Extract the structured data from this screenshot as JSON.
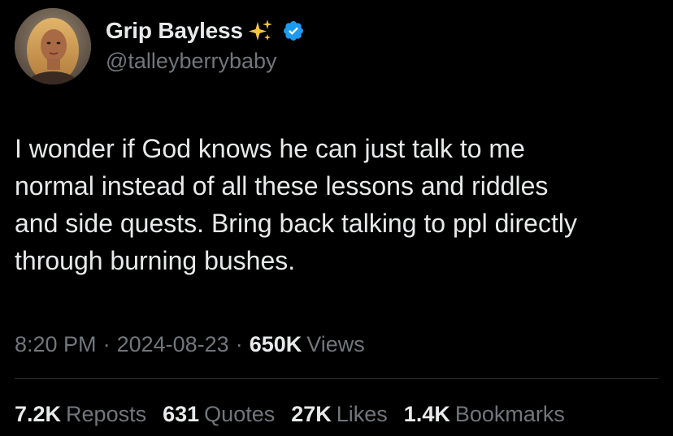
{
  "user": {
    "display_name": "Grip Bayless",
    "handle": "@talleyberrybaby",
    "verified": true,
    "name_emoji": "sparkles-icon",
    "avatar": "profile-photo"
  },
  "tweet": {
    "text_lines": [
      "I wonder if God knows he can just talk to me",
      "normal instead of all these lessons and riddles",
      "and side quests. Bring back talking to ppl directly",
      "through burning bushes."
    ]
  },
  "meta": {
    "time": "8:20 PM",
    "separator": "·",
    "date": "2024-08-23",
    "views_count": "650K",
    "views_label": "Views"
  },
  "stats": {
    "reposts": {
      "count": "7.2K",
      "label": "Reposts"
    },
    "quotes": {
      "count": "631",
      "label": "Quotes"
    },
    "likes": {
      "count": "27K",
      "label": "Likes"
    },
    "bookmarks": {
      "count": "1.4K",
      "label": "Bookmarks"
    }
  },
  "colors": {
    "background": "#000000",
    "primary_text": "#e7e9ea",
    "secondary_text": "#71767b",
    "verified_blue": "#1d9bf0",
    "sparkle_gold": "#f5c542",
    "divider": "#2f3336"
  }
}
